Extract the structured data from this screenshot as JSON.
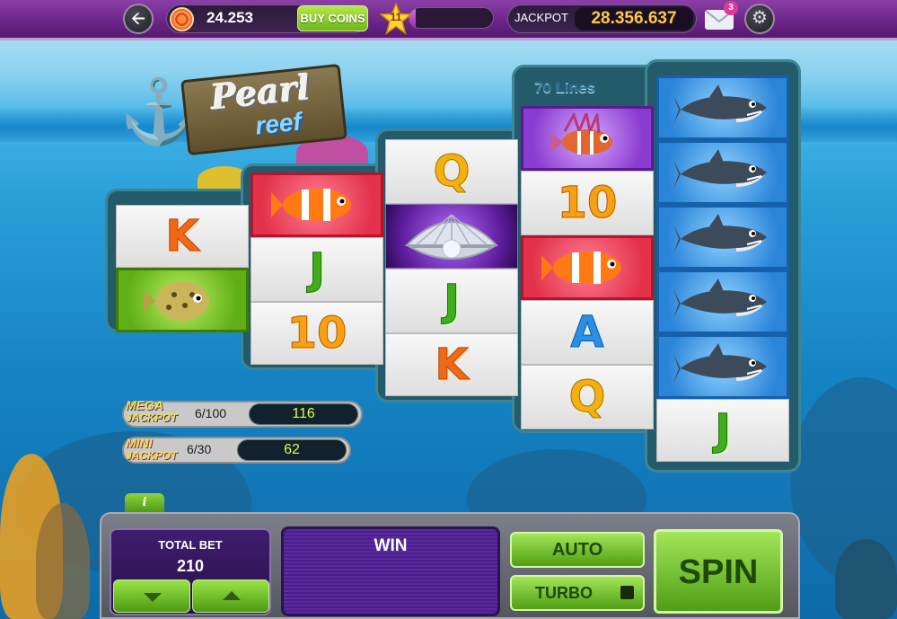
{
  "topbar": {
    "coins": "24.253",
    "buy_coins_label": "BUY COINS",
    "level": "11",
    "xp_progress_percent": 8,
    "jackpot_label": "JACKPOT",
    "jackpot_value": "28.356.637",
    "mail_badge": "3"
  },
  "game": {
    "logo_line1": "Pearl",
    "logo_line2": "reef",
    "lines_label": "70 Lines"
  },
  "reels": [
    [
      {
        "symbol": "K",
        "bg": "plain"
      },
      {
        "symbol": "pufferfish",
        "bg": "green"
      }
    ],
    [
      {
        "symbol": "clownfish",
        "bg": "red"
      },
      {
        "symbol": "J",
        "bg": "plain"
      },
      {
        "symbol": "10",
        "bg": "plain"
      }
    ],
    [
      {
        "symbol": "Q",
        "bg": "plain"
      },
      {
        "symbol": "pearl-shell",
        "bg": "shell"
      },
      {
        "symbol": "J",
        "bg": "plain"
      },
      {
        "symbol": "K",
        "bg": "plain"
      }
    ],
    [
      {
        "symbol": "lionfish",
        "bg": "purple"
      },
      {
        "symbol": "10",
        "bg": "plain"
      },
      {
        "symbol": "clownfish",
        "bg": "red"
      },
      {
        "symbol": "A",
        "bg": "plain"
      },
      {
        "symbol": "Q",
        "bg": "plain"
      }
    ],
    [
      {
        "symbol": "shark",
        "bg": "blue"
      },
      {
        "symbol": "shark",
        "bg": "blue"
      },
      {
        "symbol": "shark",
        "bg": "blue"
      },
      {
        "symbol": "shark",
        "bg": "blue"
      },
      {
        "symbol": "shark",
        "bg": "blue"
      },
      {
        "symbol": "J",
        "bg": "plain"
      }
    ]
  ],
  "jackpots": {
    "mega": {
      "line1": "MEGA",
      "line2": "JACKPOT",
      "count": "6/100",
      "value": "116"
    },
    "mini": {
      "line1": "MINI",
      "line2": "JACKPOT",
      "count": "6/30",
      "value": "62"
    }
  },
  "controls": {
    "info_label": "i",
    "total_bet_label": "TOTAL BET",
    "total_bet_value": "210",
    "win_label": "WIN",
    "auto_label": "AUTO",
    "turbo_label": "TURBO",
    "spin_label": "SPIN"
  },
  "colors": {
    "topbar": "#6a2487",
    "accent_green": "#6fb81c",
    "jackpot_gold": "#ffc64a",
    "water": "#1583c4"
  }
}
